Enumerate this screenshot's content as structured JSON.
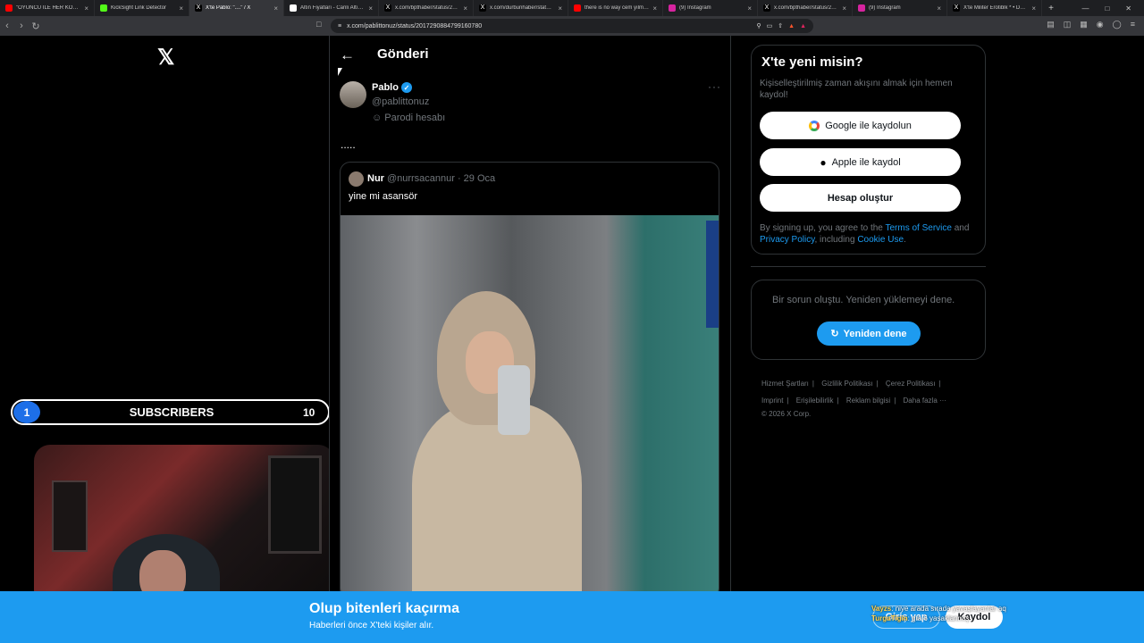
{
  "browser": {
    "tabs": [
      {
        "title": "\"OYUNCU İLE HER KONUDA A",
        "icon": "youtube-icon",
        "color": "#ff0000"
      },
      {
        "title": "KickSight Link Detector",
        "icon": "kicksight-icon",
        "color": "#53fc18"
      },
      {
        "title": "X'te Pablo: \"....\" / X",
        "icon": "x-icon",
        "color": "#000000",
        "active": true
      },
      {
        "title": "Altın Fiyatları - Canlı Altın Kuru",
        "icon": "haber-icon",
        "color": "#ffffff"
      },
      {
        "title": "x.com/bpthaber/status/20172",
        "icon": "x-icon",
        "color": "#000000"
      },
      {
        "title": "x.com/durbunhaber/status/20",
        "icon": "x-icon",
        "color": "#000000"
      },
      {
        "title": "there is no way cem yılmaz pe",
        "icon": "youtube-icon",
        "color": "#ff0000"
      },
      {
        "title": "(9) Instagram",
        "icon": "instagram-icon",
        "color": "#d6249f"
      },
      {
        "title": "x.com/bpthaber/status/20172",
        "icon": "x-icon",
        "color": "#000000"
      },
      {
        "title": "(9) Instagram",
        "icon": "instagram-icon",
        "color": "#d6249f"
      },
      {
        "title": "X'te Militer Erotiblk * • Donsk",
        "icon": "x-icon",
        "color": "#000000"
      }
    ],
    "url": "x.com/pablittonuz/status/2017290884799160780"
  },
  "stream": {
    "subscribers_current": "1",
    "subscribers_label": "SUBSCRIBERS",
    "subscribers_goal": "10",
    "chat_lines": [
      {
        "user": "Vayzs",
        "text": ": niye arada sırada yavaşlayanlar aq"
      },
      {
        "user": "TurgaTigin",
        "text": ": gta 6 yasaklanmış"
      }
    ]
  },
  "post": {
    "page_title": "Gönderi",
    "author_name": "Pablo",
    "author_handle": "@pablittonuz",
    "parody_label": "Parodi hesabı",
    "body": ".....",
    "quote": {
      "name": "Nur",
      "handle": "@nurrsacannur",
      "date": "· 29 Oca",
      "text": "yine mi asansör"
    }
  },
  "sidebar": {
    "signup_title": "X'te yeni misin?",
    "signup_desc": "Kişiselleştirilmiş zaman akışını almak için hemen kaydol!",
    "google_btn": "Google ile kaydolun",
    "apple_btn": "Apple ile kaydol",
    "create_btn": "Hesap oluştur",
    "legal_prefix": "By signing up, you agree to the ",
    "legal_tos": "Terms of Service",
    "legal_and": " and ",
    "legal_privacy": "Privacy Policy",
    "legal_including": ", including ",
    "legal_cookie": "Cookie Use",
    "legal_end": ".",
    "error_text": "Bir sorun oluştu. Yeniden yüklemeyi dene.",
    "retry_btn": "Yeniden dene",
    "footer_links": [
      "Hizmet Şartları",
      "Gizlilik Politikası",
      "Çerez Politikası",
      "Imprint",
      "Erişilebilirlik",
      "Reklam bilgisi",
      "Daha fazla ···"
    ],
    "copyright": "© 2026 X Corp."
  },
  "banner": {
    "title": "Olup bitenleri kaçırma",
    "subtitle": "Haberleri önce X'teki kişiler alır.",
    "login_btn": "Giriş yap",
    "signup_btn": "Kaydol"
  },
  "colors": {
    "accent": "#1d9bf0",
    "background": "#000000",
    "border": "#2f3336"
  }
}
